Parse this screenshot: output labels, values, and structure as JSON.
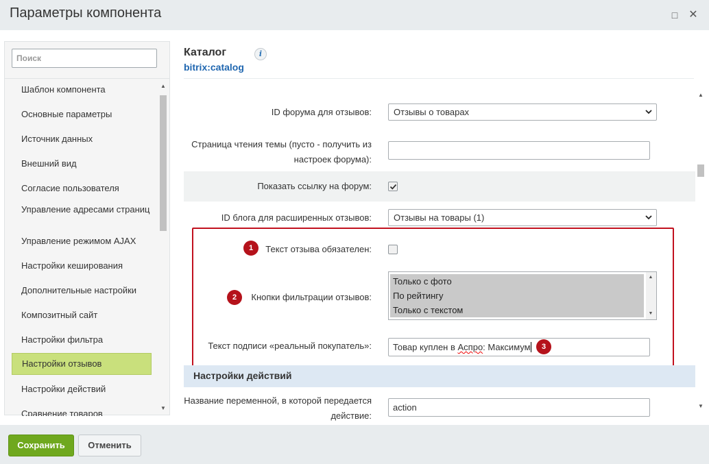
{
  "window": {
    "title": "Параметры компонента",
    "maximize_icon": "square-icon",
    "close_icon": "close-icon"
  },
  "sidebar": {
    "search_placeholder": "Поиск",
    "items": [
      {
        "label": "Шаблон компонента"
      },
      {
        "label": "Основные параметры"
      },
      {
        "label": "Источник данных"
      },
      {
        "label": "Внешний вид"
      },
      {
        "label": "Согласие пользователя"
      },
      {
        "label": "Управление адресами страниц"
      },
      {
        "label": "Управление режимом AJAX"
      },
      {
        "label": "Настройки кеширования"
      },
      {
        "label": "Дополнительные настройки"
      },
      {
        "label": "Композитный сайт"
      },
      {
        "label": "Настройки фильтра"
      },
      {
        "label": "Настройки отзывов",
        "active": true
      },
      {
        "label": "Настройки действий"
      },
      {
        "label": "Сравнение товаров"
      }
    ],
    "active_color": "#c9e07c"
  },
  "component": {
    "title": "Каталог",
    "code": "bitrix:catalog",
    "info_icon": "i"
  },
  "fields": {
    "forum_id": {
      "label": "ID форума для отзывов:",
      "value": "Отзывы о товарах"
    },
    "topic_page": {
      "label": "Страница чтения темы (пусто - получить из настроек форума):",
      "value": ""
    },
    "show_forum_link": {
      "label": "Показать ссылку на форум:",
      "checked": true
    },
    "blog_id": {
      "label": "ID блога для расширенных отзывов:",
      "value": "Отзывы на товары (1)"
    },
    "review_text_required": {
      "label": "Текст отзыва обязателен:",
      "checked": false,
      "badge": "1"
    },
    "filter_buttons": {
      "label": "Кнопки фильтрации отзывов:",
      "badge": "2",
      "options": [
        "Только с фото",
        "По рейтингу",
        "Только с текстом"
      ]
    },
    "buyer_caption": {
      "label": "Текст подписи «реальный покупатель»:",
      "value_prefix": "Товар куплен в ",
      "value_underlined": "Аспро",
      "value_suffix": ": Максимум",
      "badge": "3"
    },
    "action_variable": {
      "label": "Название переменной, в которой передается действие:",
      "value": "action"
    }
  },
  "section": {
    "actions_title": "Настройки действий"
  },
  "footer": {
    "save_label": "Сохранить",
    "cancel_label": "Отменить"
  },
  "colors": {
    "accent_green": "#6fa81e",
    "highlight_red": "#c1101e",
    "section_blue": "#dde8f3",
    "link_blue": "#2067b0"
  }
}
